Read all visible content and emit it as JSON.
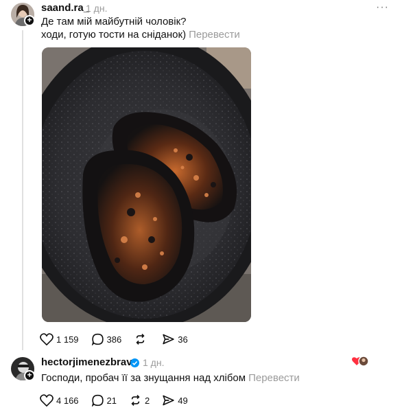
{
  "post1": {
    "username": "saand.ra_",
    "time": "1 дн.",
    "more": "···",
    "line1": "Де там мій майбутній чоловік?",
    "line2": "ходи, готую тости на сніданок)",
    "translate": "Перевести",
    "image_icon": "burnt-toast-pan-photo",
    "likes": "1 159",
    "comments": "386",
    "reposts": "",
    "shares": "36"
  },
  "post2": {
    "username": "hectorjimenezbravo",
    "time": "1 дн.",
    "text": "Господи, пробач її за знущання над хлібом",
    "translate": "Перевести",
    "likes": "4 166",
    "comments": "21",
    "reposts": "2",
    "shares": "49"
  },
  "colors": {
    "accent": "#0095f6",
    "muted": "#9a9a9a",
    "heart": "#ff3040"
  }
}
